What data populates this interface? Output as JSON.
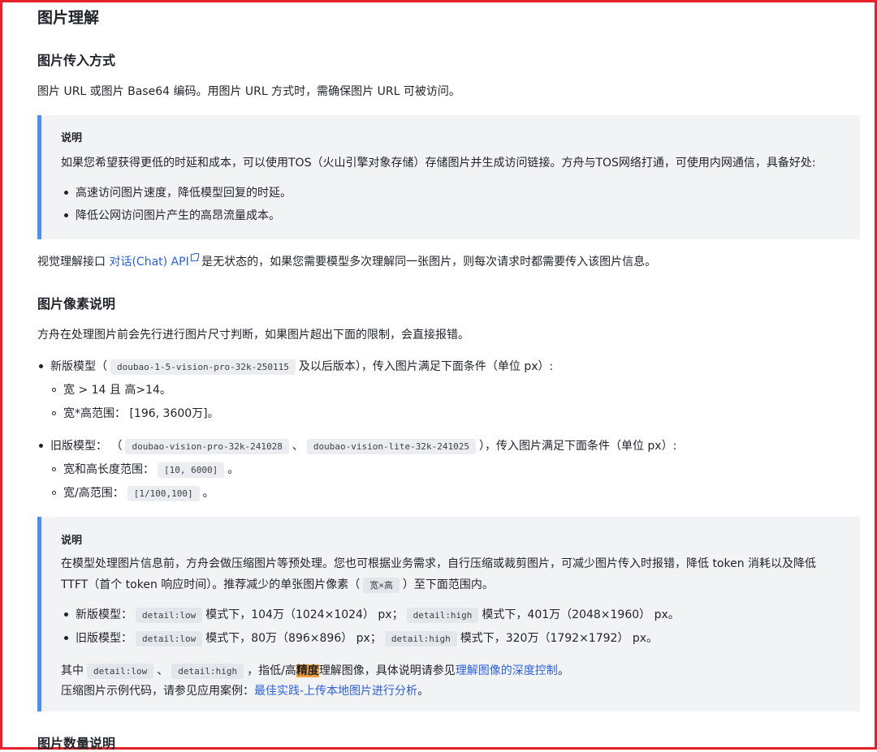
{
  "colors": {
    "border": "#e8202a",
    "accent": "#4e8ef7",
    "link": "#2a5fe0",
    "highlight": "#f5a03a",
    "note_bg": "#f2f3f5"
  },
  "section_title": "图片理解",
  "input": {
    "heading": "图片传入方式",
    "desc": "图片 URL 或图片 Base64 编码。用图片 URL 方式时，需确保图片 URL 可被访问。",
    "note": {
      "title": "说明",
      "text": "如果您希望获得更低的时延和成本，可以使用TOS（火山引擎对象存储）存储图片并生成访问链接。方舟与TOS网络打通，可使用内网通信，具备好处:",
      "bullets": [
        "高速访问图片速度，降低模型回复的时延。",
        "降低公网访问图片产生的高昂流量成本。"
      ]
    },
    "stateless": {
      "prefix": "视觉理解接口 ",
      "link": "对话(Chat) API",
      "suffix": " 是无状态的，如果您需要模型多次理解同一张图片，则每次请求时都需要传入该图片信息。"
    }
  },
  "pixels": {
    "heading": "图片像素说明",
    "desc": "方舟在处理图片前会先行进行图片尺寸判断，如果图片超出下面的限制，会直接报错。",
    "new": {
      "prefix": "新版模型（",
      "code": "doubao-1-5-vision-pro-32k-250115",
      "suffix": "及以后版本），传入图片满足下面条件（单位 px）:",
      "sub1": "宽 > 14 且 高>14。",
      "sub2": "宽*高范围： [196, 3600万]。"
    },
    "old": {
      "prefix": "旧版模型： （",
      "code1": "doubao-vision-pro-32k-241028",
      "sep": "、",
      "code2": "doubao-vision-lite-32k-241025",
      "suffix": "），传入图片满足下面条件（单位 px）:",
      "sub1_prefix": "宽和高长度范围：",
      "sub1_code": "[10, 6000]",
      "sub1_suffix": "。",
      "sub2_prefix": "宽/高范围：",
      "sub2_code": "[1/100,100]",
      "sub2_suffix": "。"
    },
    "note": {
      "title": "说明",
      "line1": "在模型处理图片信息前，方舟会做压缩图片等预处理。您也可根据业务需求，自行压缩或裁剪图片，可减少图片传入时报错，降低 token 消耗以及降低",
      "line2_prefix": "TTFT（首个 token 响应时间）。推荐减少的单张图片像素（",
      "line2_code": "宽×高",
      "line2_suffix": "）至下面范围内。",
      "b1_prefix": "新版模型：",
      "b1_code1": "detail:low",
      "b1_mid": "模式下，104万（1024×1024） px；",
      "b1_code2": "detail:high",
      "b1_suffix": "模式下，401万（2048×1960） px。",
      "b2_prefix": "旧版模型：",
      "b2_code1": "detail:low",
      "b2_mid": "模式下，80万（896×896） px；",
      "b2_code2": "detail:high",
      "b2_suffix": "模式下，320万（1792×1792） px。",
      "p1_prefix": "其中",
      "p1_code1": "detail:low",
      "p1_sep": "、",
      "p1_code2": "detail:high",
      "p1_mid": "，指低/高",
      "p1_hl": "精度",
      "p1_mid2": "理解图像，具体说明请参见",
      "p1_link": "理解图像的深度控制",
      "p1_end": "。",
      "p2_prefix": "压缩图片示例代码，请参见应用案例：",
      "p2_link": "最佳实践-上传本地图片进行分析",
      "p2_end": "。"
    }
  },
  "count_heading": "图片数量说明"
}
